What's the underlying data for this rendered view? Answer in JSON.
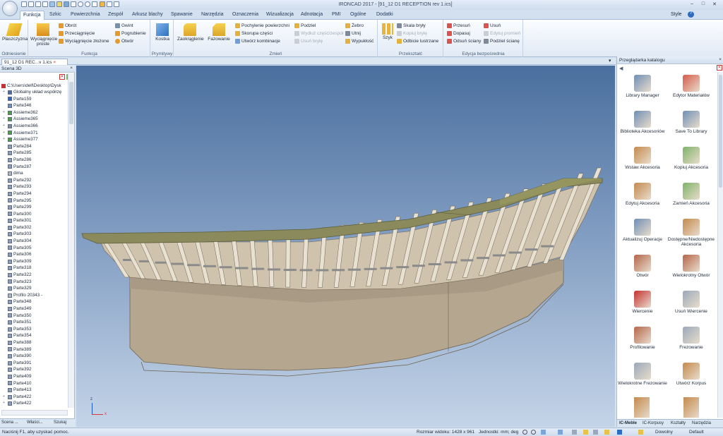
{
  "app": {
    "title": "IRONCAD 2017 - [91_12 D1 RECEPTION rev 1.ics]",
    "style_label": "Style",
    "help_label": "?"
  },
  "tabs": [
    "Funkcja",
    "Szkic",
    "Powierzchnia",
    "Zespół",
    "Arkusz blachy",
    "Spawanie",
    "Narzędzia",
    "Oznaczenia",
    "Wizualizacja",
    "Adnotacja",
    "PMI",
    "Ogólne",
    "Dodatki"
  ],
  "ribbon": {
    "groups": {
      "odniesienie": "Odniesienie",
      "funkcja": "Funkcja",
      "prymitywy": "Prymitywy",
      "zmien": "Zmień",
      "przeksztalc": "Przekształć",
      "edycja": "Edycja bezpośrednia"
    },
    "plaszczyzna": "Płaszczyzna",
    "wyciagniecie": "Wyciągnięcie proste",
    "obrot": "Obrót",
    "przeciagniecie": "Przeciągnięcie",
    "wyciagniecie_zlozone": "Wyciągnięcie złożone",
    "gwint": "Gwint",
    "pogrubienie": "Pogrubienie",
    "otwor": "Otwór",
    "kostka": "Kostka",
    "zaokraglenie": "Zaokrąglenie",
    "fazowanie": "Fazowanie",
    "pochylenie": "Pochylenie powierzchni",
    "skorupa": "Skorupa części",
    "utworz_kombinacje": "Utwórz kombinacje",
    "podziel": "Podziel",
    "wydluz": "Wydłuż część/zespół",
    "usun_bryle": "Usuń bryłę",
    "zebro": "Żebro",
    "utnij": "Utnij",
    "wypuklosc": "Wypukłość",
    "szyk": "Szyk",
    "skala_bryly": "Skala bryły",
    "kopiuj_bryle": "Kopiuj bryłę",
    "odbicie": "Odbicie lustrzane",
    "przesun": "Przesuń",
    "dopasuj": "Dopasuj",
    "odsun": "Odsuń ściany",
    "usun": "Usuń",
    "edytuj_promien": "Edytuj promień",
    "podziel_sciane": "Podziel ścianę"
  },
  "document_tab": "91_12 D1 REC...v 1.ics",
  "scene_panel": {
    "title": "Scena 3D",
    "root_path": "C:\\Users\\dell\\Desktop\\Dysk",
    "items": [
      "Globalny układ współrzę",
      "Parte159",
      "Parte346",
      "Assieme362",
      "Assieme365",
      "Assieme366",
      "Assieme371",
      "Assieme377",
      "Parte284",
      "Parte285",
      "Parte286",
      "Parte287",
      "dima",
      "Parte292",
      "Parte293",
      "Parte294",
      "Parte295",
      "Parte299",
      "Parte300",
      "Parte301",
      "Parte302",
      "Parte303",
      "Parte304",
      "Parte305",
      "Parte306",
      "Parte309",
      "Parte318",
      "Parte322",
      "Parte323",
      "Parte329",
      "Profilo 20343 -",
      "Parte348",
      "Parte349",
      "Parte350",
      "Parte351",
      "Parte353",
      "Parte354",
      "Parte388",
      "Parte389",
      "Parte390",
      "Parte391",
      "Parte392",
      "Parte409",
      "Parte410",
      "Parte413",
      "Parte422",
      "Parte422"
    ],
    "tabs": [
      "Scena ...",
      "Właści...",
      "Szukaj"
    ]
  },
  "catalog": {
    "title": "Przeglądarka katalogu",
    "items": [
      "Library Manager",
      "Edytor Materiałów",
      "Biblioteka Akcesoriów",
      "Save To Library",
      "Wstaw Akcesoria",
      "Kopiuj Akcesoria",
      "Edytuj Akcesoria",
      "Zamień Akcesoria",
      "Aktualizuj Operacje",
      "Dostępne/Niedostępne Akcesoria",
      "Otwór",
      "Wielokrotny Otwór",
      "Wiercenie",
      "Usuń Wiercenie",
      "Profilowanie",
      "Frezowanie",
      "Wielokrotne Frezowanie",
      "Utwórz Korpus"
    ],
    "tabs": [
      "IC-Meble",
      "IC-Korpusy",
      "Kształty",
      "Narzędzia"
    ]
  },
  "status": {
    "help": "Naciśnij F1, aby uzyskać pomoc.",
    "viewsize": "Rozmiar widoku: 1428 x 961",
    "units": "Jednostki: mm; deg",
    "mode": "Dowolny",
    "default": "Default"
  },
  "axes": {
    "x": "x",
    "y": "y",
    "z": "z"
  },
  "colors": {
    "accent": "#f5b73b",
    "model_top": "#8a8a5c",
    "model_body": "#b9aa92",
    "sky": "#5b7ea9"
  }
}
